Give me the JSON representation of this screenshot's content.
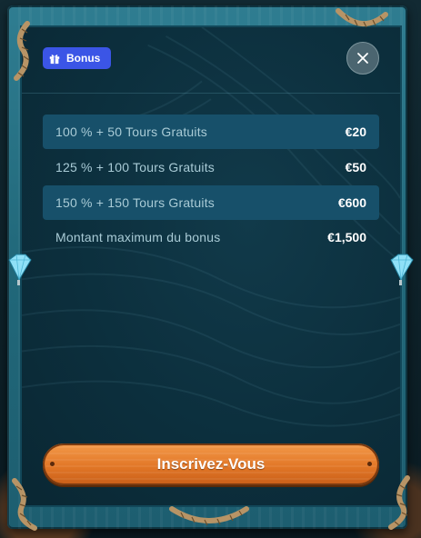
{
  "header": {
    "badge_label": "Bonus",
    "badge_icon": "gift-icon",
    "close_icon": "close-icon"
  },
  "bonus_rows": [
    {
      "label": "100 % + 50 Tours Gratuits",
      "value": "€20"
    },
    {
      "label": "125 % + 100 Tours Gratuits",
      "value": "€50"
    },
    {
      "label": "150 % + 150 Tours Gratuits",
      "value": "€600"
    },
    {
      "label": "Montant maximum du bonus",
      "value": "€1,500"
    }
  ],
  "cta": {
    "label": "Inscrivez-Vous"
  },
  "colors": {
    "badge": "#3b55e6",
    "highlight_row": "#17506a",
    "cta_orange": "#e27727",
    "frame_teal": "#21687a"
  }
}
